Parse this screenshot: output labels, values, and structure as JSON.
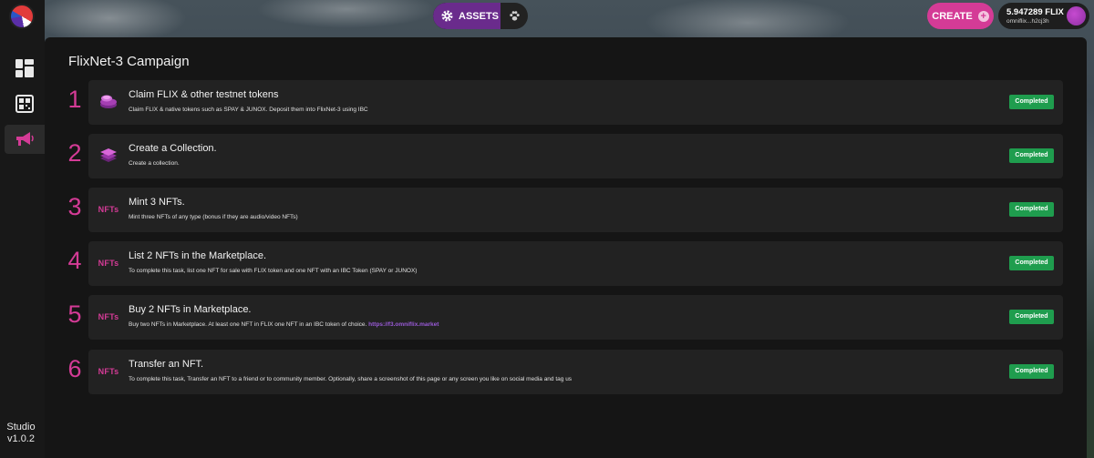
{
  "sidebar": {
    "items": [
      {
        "icon": "dashboard-icon"
      },
      {
        "icon": "qr-code-icon"
      },
      {
        "icon": "megaphone-icon",
        "active": true
      }
    ],
    "footer_name": "Studio",
    "footer_version": "v1.0.2"
  },
  "topnav": {
    "assets_label": "ASSETS",
    "create_label": "CREATE",
    "create_plus": "+",
    "wallet_balance": "5.947289 FLIX",
    "wallet_address": "omniflix...h2cj3h"
  },
  "campaign": {
    "title": "FlixNet-3 Campaign",
    "nfts_label": "NFTs",
    "tasks": [
      {
        "number": "1",
        "icon": "coins-icon",
        "title": "Claim FLIX & other testnet tokens",
        "description": "Claim FLIX & native tokens such as SPAY & JUNOX. Deposit them into FlixNet-3 using IBC",
        "link": "",
        "status": "Completed"
      },
      {
        "number": "2",
        "icon": "collection-layers-icon",
        "title": "Create a Collection.",
        "description": "Create a collection.",
        "link": "",
        "status": "Completed"
      },
      {
        "number": "3",
        "icon": "nfts-icon",
        "title": "Mint 3 NFTs.",
        "description": "Mint three NFTs of any type (bonus if they are audio/video NFTs)",
        "link": "",
        "status": "Completed"
      },
      {
        "number": "4",
        "icon": "nfts-icon",
        "title": "List 2 NFTs in the Marketplace.",
        "description": "To complete this task, list one NFT for sale with FLIX token and one NFT with an IBC Token (SPAY or JUNOX)",
        "link": "",
        "status": "Completed"
      },
      {
        "number": "5",
        "icon": "nfts-icon",
        "title": "Buy 2 NFTs in Marketplace.",
        "description": "Buy two NFTs in Marketplace. At least one NFT in FLIX one NFT in an IBC token of choice.",
        "link": "https://f3.omniflix.market",
        "status": "Completed"
      },
      {
        "number": "6",
        "icon": "nfts-icon",
        "title": "Transfer an NFT.",
        "description": "To complete this task, Transfer an NFT to a friend or to community member. Optionally, share a screenshot of this page or any screen you like on social media and tag us",
        "link": "",
        "status": "Completed"
      }
    ]
  },
  "colors": {
    "accent": "#d43b96",
    "assets_bg": "#6a2b8c",
    "completed": "#1f9d4e",
    "panel": "#151515",
    "card": "#222222"
  }
}
